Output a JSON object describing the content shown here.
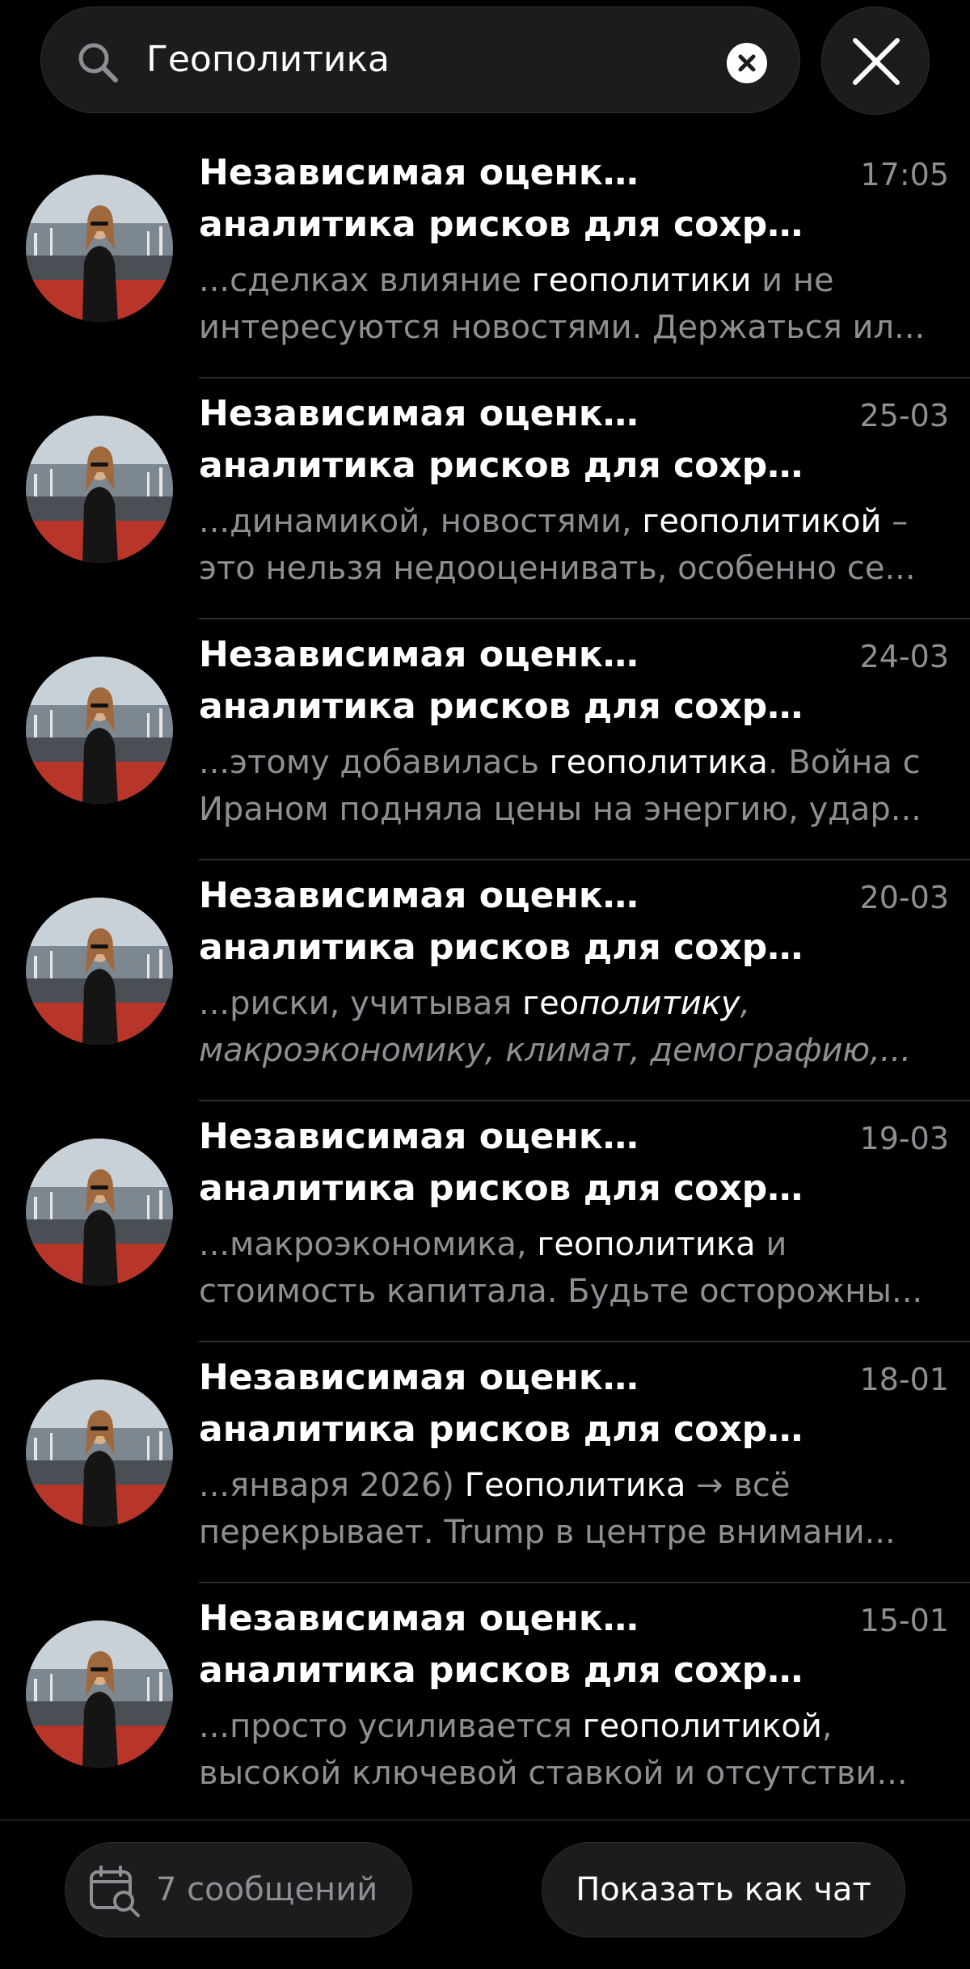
{
  "search": {
    "query": "Геополитика",
    "clear_icon": "clear-icon",
    "close_icon": "close-icon"
  },
  "results": [
    {
      "title_line1": "Независимая оценка и",
      "title_line2": "аналитика рисков для сохрана...",
      "time": "17:05",
      "snippet_line1": [
        {
          "text": "...сделках влияние ",
          "hl": false
        },
        {
          "text": "геополитики",
          "hl": true
        },
        {
          "text": " и не",
          "hl": false
        }
      ],
      "snippet_line2": [
        {
          "text": "интересуются новостями. Держаться ил...",
          "hl": false
        }
      ]
    },
    {
      "title_line1": "Независимая оценка и",
      "title_line2": "аналитика рисков для сохран...",
      "time": "25-03",
      "snippet_line1": [
        {
          "text": "...динамикой, новостями, ",
          "hl": false
        },
        {
          "text": "геополитикой",
          "hl": true
        },
        {
          "text": " –",
          "hl": false
        }
      ],
      "snippet_line2": [
        {
          "text": "это нельзя недооценивать, особенно се...",
          "hl": false
        }
      ]
    },
    {
      "title_line1": "Независимая оценка и",
      "title_line2": "аналитика рисков для сохран...",
      "time": "24-03",
      "snippet_line1": [
        {
          "text": "...этому добавилась ",
          "hl": false
        },
        {
          "text": "геополитика",
          "hl": true
        },
        {
          "text": ". Война с",
          "hl": false
        }
      ],
      "snippet_line2": [
        {
          "text": "Ираном подняла цены на энергию, удар...",
          "hl": false
        }
      ]
    },
    {
      "title_line1": "Независимая оценка и",
      "title_line2": "аналитика рисков для сохран...",
      "time": "20-03",
      "snippet_line1": [
        {
          "text": "...риски, учитывая ",
          "hl": false
        },
        {
          "text": "гео",
          "hl": true
        },
        {
          "text": "политику",
          "hl": true,
          "italic": true
        },
        {
          "text": ",",
          "hl": false,
          "italic": true
        }
      ],
      "snippet_line2": [
        {
          "text": "макроэкономику, климат, демографию,...",
          "hl": false,
          "italic": true
        }
      ]
    },
    {
      "title_line1": "Независимая оценка и",
      "title_line2": "аналитика рисков для сохрана...",
      "time": "19-03",
      "snippet_line1": [
        {
          "text": "...макроэкономика, ",
          "hl": false
        },
        {
          "text": "геополитика",
          "hl": true
        },
        {
          "text": " и",
          "hl": false
        }
      ],
      "snippet_line2": [
        {
          "text": "стоимость капитала. Будьте осторожны...",
          "hl": false
        }
      ]
    },
    {
      "title_line1": "Независимая оценка и",
      "title_line2": "аналитика рисков для сохрана...",
      "time": "18-01",
      "snippet_line1": [
        {
          "text": "...января 2026) ",
          "hl": false
        },
        {
          "text": "Геополитика",
          "hl": true
        },
        {
          "text": " → всё",
          "hl": false
        }
      ],
      "snippet_line2": [
        {
          "text": "перекрывает.  Trump в центре внимани...",
          "hl": false
        }
      ]
    },
    {
      "title_line1": "Независимая оценка и",
      "title_line2": "аналитика рисков для сохрана...",
      "time": "15-01",
      "snippet_line1": [
        {
          "text": "...просто усиливается ",
          "hl": false
        },
        {
          "text": "геополитикой",
          "hl": true
        },
        {
          "text": ",",
          "hl": false
        }
      ],
      "snippet_line2": [
        {
          "text": "высокой ключевой ставкой и отсутстви...",
          "hl": false
        }
      ]
    }
  ],
  "footer": {
    "count_label": "7 сообщений",
    "count_icon": "calendar-search-icon",
    "show_as_chat_label": "Показать как чат"
  },
  "colors": {
    "background": "#000000",
    "surface": "#1c1c1e",
    "secondary_text": "#8e8e93",
    "primary_text": "#ffffff"
  }
}
